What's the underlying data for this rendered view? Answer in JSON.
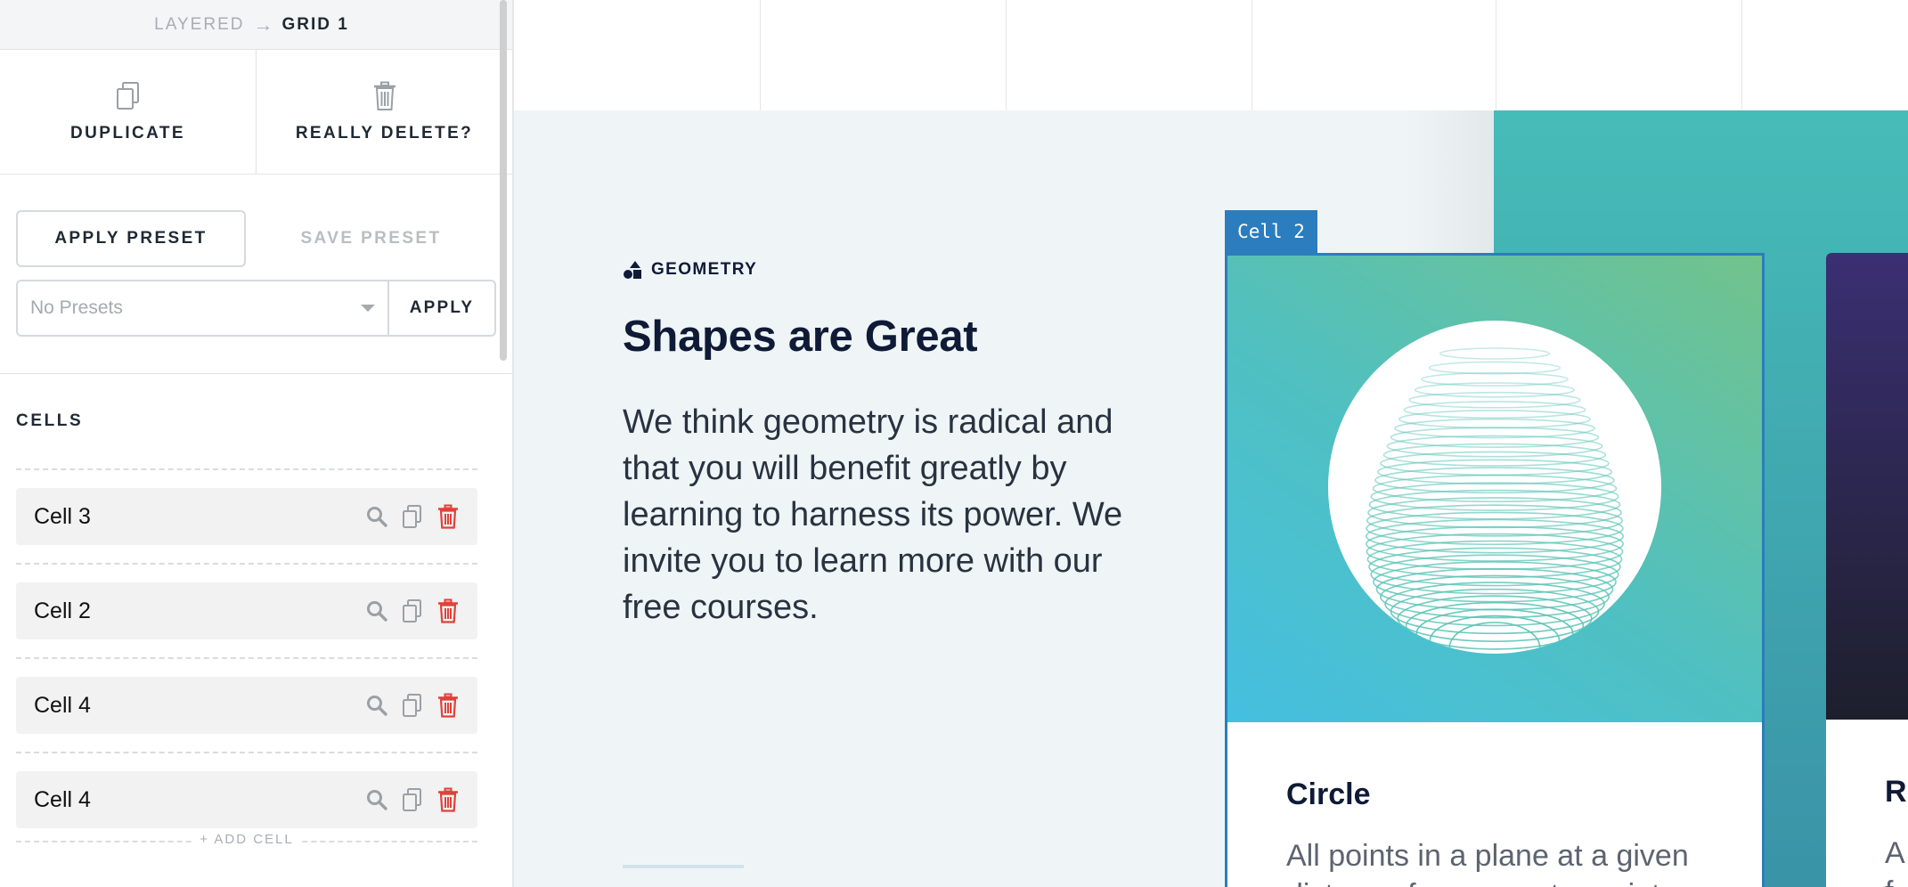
{
  "sidebar": {
    "breadcrumb": {
      "parent": "LAYERED",
      "separator": "→",
      "current": "GRID 1"
    },
    "actions": {
      "duplicate": "DUPLICATE",
      "delete": "REALLY DELETE?"
    },
    "preset": {
      "apply_preset": "APPLY PRESET",
      "save_preset": "SAVE PRESET",
      "select_value": "No Presets",
      "apply": "APPLY"
    },
    "cells_title": "CELLS",
    "cells": [
      {
        "label": "Cell 3"
      },
      {
        "label": "Cell 2"
      },
      {
        "label": "Cell 4"
      },
      {
        "label": "Cell 4"
      }
    ],
    "add_cell": "ADD CELL",
    "add_cell_glyph": "+"
  },
  "canvas": {
    "eyebrow": "GEOMETRY",
    "headline": "Shapes are Great",
    "body": "We think geometry is radical and that you will benefit greatly by learning to harness its power. We invite you to learn more with our free courses.",
    "selected_cell_label": "Cell 2",
    "card": {
      "title": "Circle",
      "description": "All points in a plane at a given distance from a center point."
    },
    "card_next": {
      "title": "R",
      "description": "A f"
    }
  },
  "colors": {
    "selection": "#2b7dbd",
    "delete_red": "#e0413a",
    "section_bg": "#eff5f7",
    "teal": "#46bcb8",
    "heading": "#0f1a36"
  },
  "icons": {
    "duplicate": "duplicate-icon",
    "delete": "trash-icon",
    "search": "search-icon",
    "geometry": "shapes-icon",
    "caret": "chevron-down-icon"
  }
}
